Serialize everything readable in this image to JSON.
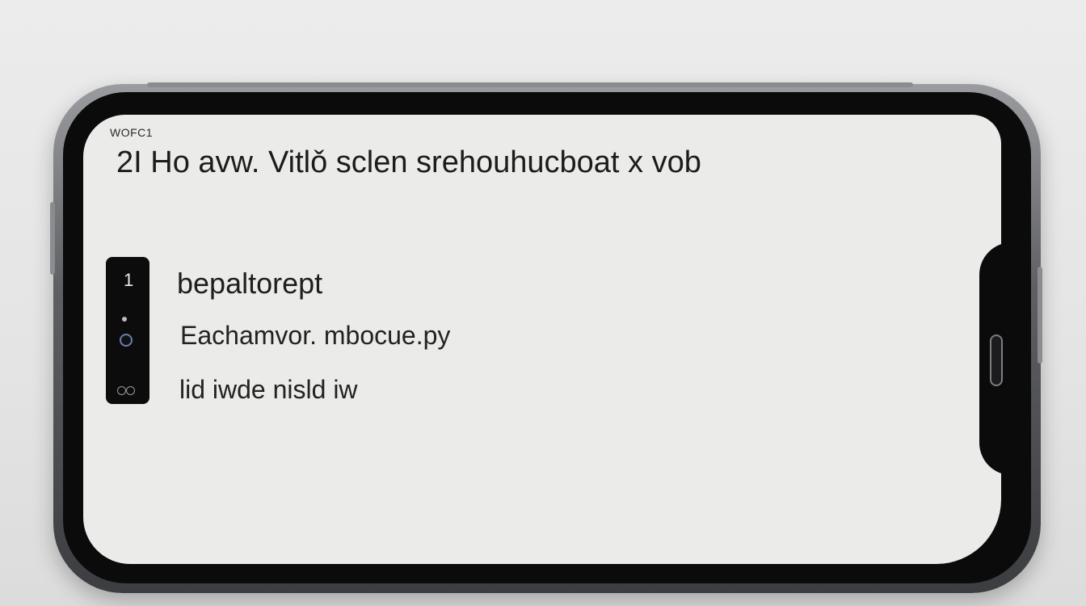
{
  "screen": {
    "top_label": "WOFC1",
    "headline": "2I Ho avw. Vitl⁠ǒ sclen srehouhucboat x vob",
    "camera_number": "1",
    "line_a": "bepaltorept",
    "line_b": "Eachamvor. mbocue.py",
    "line_c": "lid iwde nisld iw"
  },
  "colors": {
    "screen_bg": "#ebebea",
    "bezel": "#0b0b0c",
    "frame": "#5e6064",
    "text": "#1c1c1c"
  },
  "icons": [
    "camera-lens-icon",
    "sensor-dot-icon",
    "dual-sensor-icon",
    "home-indicator-icon"
  ]
}
